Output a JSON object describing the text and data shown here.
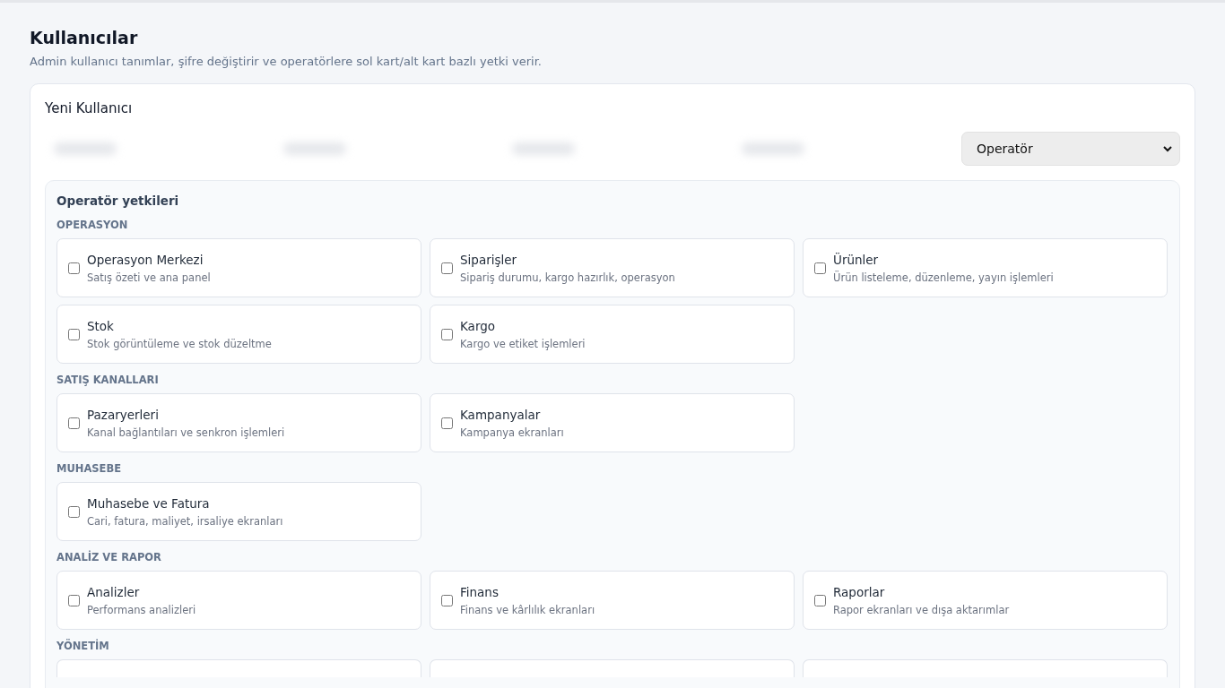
{
  "page": {
    "title": "Kullanıcılar",
    "subtitle": "Admin kullanıcı tanımlar, şifre değiştirir ve operatörlere sol kart/alt kart bazlı yetki verir."
  },
  "form": {
    "title": "Yeni Kullanıcı",
    "fields": [
      {
        "kind": "blurred"
      },
      {
        "kind": "blurred"
      },
      {
        "kind": "blurred"
      },
      {
        "kind": "blurred"
      }
    ],
    "role_select": {
      "value": "Operatör"
    }
  },
  "permissions": {
    "title": "Operatör yetkileri",
    "sections": [
      {
        "title": "OPERASYON",
        "items": [
          {
            "kind": "card",
            "title": "Operasyon Merkezi",
            "description": "Satış özeti ve ana panel",
            "checked": false
          },
          {
            "kind": "card",
            "title": "Siparişler",
            "description": "Sipariş durumu, kargo hazırlık, operasyon",
            "checked": false
          },
          {
            "kind": "card",
            "title": "Ürünler",
            "description": "Ürün listeleme, düzenleme, yayın işlemleri",
            "checked": false
          },
          {
            "kind": "card",
            "title": "Stok",
            "description": "Stok görüntüleme ve stok düzeltme",
            "checked": false
          },
          {
            "kind": "card",
            "title": "Kargo",
            "description": "Kargo ve etiket işlemleri",
            "checked": false
          }
        ]
      },
      {
        "title": "SATIŞ KANALLARI",
        "items": [
          {
            "kind": "card",
            "title": "Pazaryerleri",
            "description": "Kanal bağlantıları ve senkron işlemleri",
            "checked": false
          },
          {
            "kind": "card",
            "title": "Kampanyalar",
            "description": "Kampanya ekranları",
            "checked": false
          }
        ]
      },
      {
        "title": "MUHASEBE",
        "items": [
          {
            "kind": "card",
            "title": "Muhasebe ve Fatura",
            "description": "Cari, fatura, maliyet, irsaliye ekranları",
            "checked": false
          }
        ]
      },
      {
        "title": "ANALİZ VE RAPOR",
        "items": [
          {
            "kind": "card",
            "title": "Analizler",
            "description": "Performans analizleri",
            "checked": false
          },
          {
            "kind": "card",
            "title": "Finans",
            "description": "Finans ve kârlılık ekranları",
            "checked": false
          },
          {
            "kind": "card",
            "title": "Raporlar",
            "description": "Rapor ekranları ve dışa aktarımlar",
            "checked": false
          }
        ]
      },
      {
        "title": "YÖNETİM",
        "items": [
          {
            "kind": "cut"
          },
          {
            "kind": "cut"
          },
          {
            "kind": "cut"
          }
        ]
      }
    ]
  }
}
